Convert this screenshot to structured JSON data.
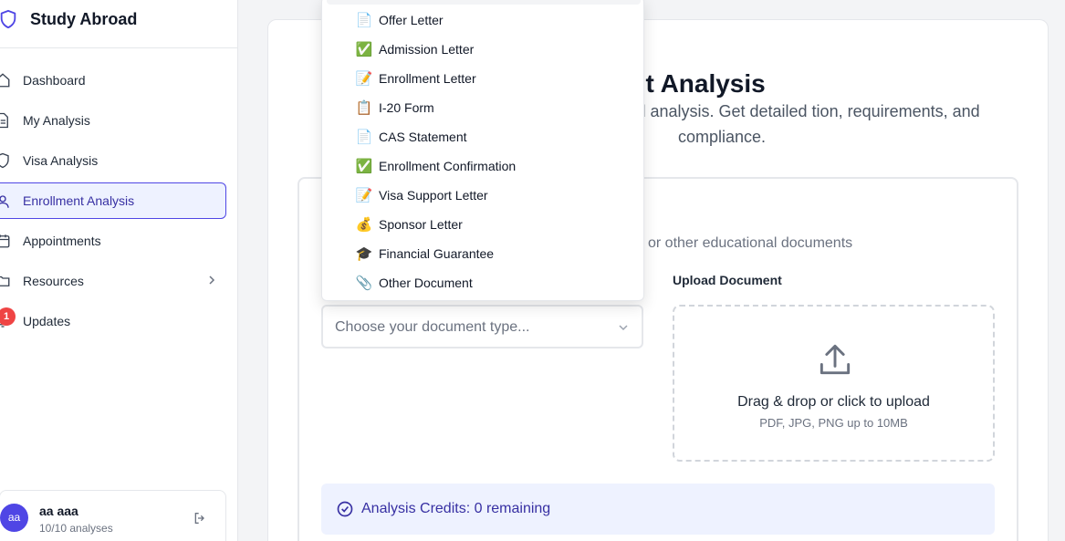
{
  "app": {
    "title": "Study Abroad"
  },
  "sidebar": {
    "items": [
      {
        "label": "Dashboard",
        "icon": "home-icon"
      },
      {
        "label": "My Analysis",
        "icon": "document-icon"
      },
      {
        "label": "Visa Analysis",
        "icon": "shield-icon"
      },
      {
        "label": "Enrollment Analysis",
        "icon": "user-icon",
        "active": true
      },
      {
        "label": "Appointments",
        "icon": "calendar-icon"
      },
      {
        "label": "Resources",
        "icon": "folder-icon"
      },
      {
        "label": "Updates",
        "icon": "bell-icon",
        "badge": "1"
      }
    ]
  },
  "user": {
    "initials": "aa",
    "name": "aa aaa",
    "meta": "10/10 analyses"
  },
  "main": {
    "title": "cument Analysis",
    "subtitle": "mprehensive AI-powered analysis. Get detailed tion, requirements, and compliance.",
    "description": "or other educational documents",
    "upload_label": "Upload Document",
    "dropzone_title": "Drag & drop or click to upload",
    "dropzone_hint": "PDF, JPG, PNG up to 10MB",
    "select_placeholder": "Choose your document type...",
    "credits_text": "Analysis Credits: 0 remaining"
  },
  "dropdown": {
    "options": [
      {
        "emoji": "📄",
        "label": "Offer Letter"
      },
      {
        "emoji": "✅",
        "label": "Admission Letter"
      },
      {
        "emoji": "📝",
        "label": "Enrollment Letter"
      },
      {
        "emoji": "📋",
        "label": "I-20 Form"
      },
      {
        "emoji": "📄",
        "label": "CAS Statement"
      },
      {
        "emoji": "✅",
        "label": "Enrollment Confirmation"
      },
      {
        "emoji": "📝",
        "label": "Visa Support Letter"
      },
      {
        "emoji": "💰",
        "label": "Sponsor Letter"
      },
      {
        "emoji": "🎓",
        "label": "Financial Guarantee"
      },
      {
        "emoji": "📎",
        "label": "Other Document"
      }
    ]
  },
  "colors": {
    "accent": "#4f46e5",
    "badge": "#ef4444",
    "credits_bg": "#eef2ff"
  }
}
